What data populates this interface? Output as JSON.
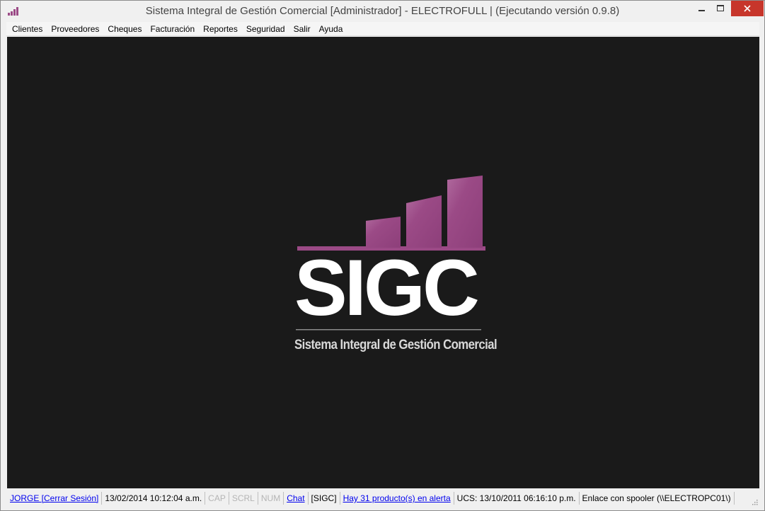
{
  "window": {
    "title": "Sistema Integral de Gestión Comercial [Administrador] - ELECTROFULL | (Ejecutando versión 0.9.8)",
    "app_icon": "bar-chart-icon",
    "controls": {
      "minimize": "minimize-icon",
      "maximize": "maximize-icon",
      "close": "close-icon"
    }
  },
  "menu": {
    "items": [
      "Clientes",
      "Proveedores",
      "Cheques",
      "Facturación",
      "Reportes",
      "Seguridad",
      "Salir",
      "Ayuda"
    ]
  },
  "logo": {
    "wordmark": "SIGC",
    "tagline": "Sistema Integral de Gestión Comercial",
    "accent_color": "#9b4a86"
  },
  "statusbar": {
    "user": "JORGE [Cerrar Sesión]",
    "datetime": "13/02/2014 10:12:04 a.m.",
    "cap": "CAP",
    "scrl": "SCRL",
    "num": "NUM",
    "chat": "Chat",
    "sigc": "[SIGC]",
    "alert": "Hay 31 producto(s) en alerta",
    "ucs": "UCS: 13/10/2011 06:16:10 p.m.",
    "spooler": "Enlace con spooler (\\\\ELECTROPC01\\)"
  }
}
